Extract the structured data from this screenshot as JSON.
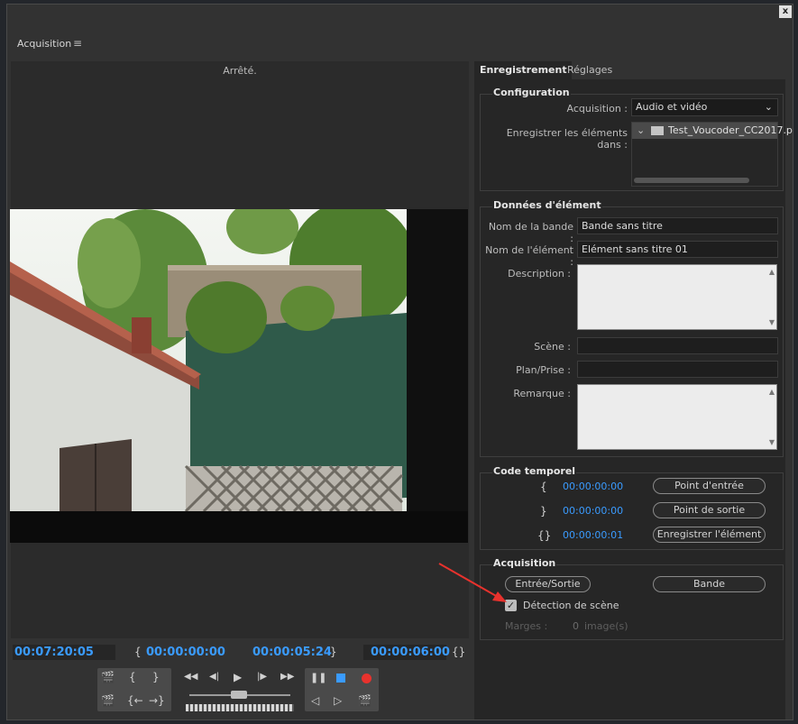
{
  "panel": {
    "title": "Acquisition",
    "menu_icon": "hamburger-icon",
    "close_label": "x"
  },
  "preview": {
    "status": "Arrêté.",
    "timecodes": {
      "current": "00:07:20:05",
      "in": "00:00:00:00",
      "duration": "00:00:05:24",
      "out": "00:00:06:00"
    }
  },
  "tabs": [
    {
      "label": "Enregistrement",
      "active": true
    },
    {
      "label": "Réglages",
      "active": false
    }
  ],
  "configuration": {
    "title": "Configuration",
    "acquisition_label": "Acquisition :",
    "acquisition_value": "Audio et vidéo",
    "save_label": "Enregistrer les éléments dans :",
    "save_folder": "Test_Voucoder_CC2017.p"
  },
  "clip_data": {
    "title": "Données d'élément",
    "tape_label": "Nom de la bande :",
    "tape_value": "Bande sans titre",
    "clip_label": "Nom de l'élément :",
    "clip_value": "Elément sans titre 01",
    "description_label": "Description :",
    "scene_label": "Scène :",
    "shot_label": "Plan/Prise :",
    "remark_label": "Remarque :"
  },
  "timecode": {
    "title": "Code temporel",
    "in_value": "00:00:00:00",
    "out_value": "00:00:00:00",
    "duration_value": "00:00:00:01",
    "set_in": "Point d'entrée",
    "set_out": "Point de sortie",
    "log_clip": "Enregistrer l'élément"
  },
  "capture": {
    "title": "Acquisition",
    "in_out_button": "Entrée/Sortie",
    "tape_button": "Bande",
    "scene_detect_label": "Détection de scène",
    "scene_detect_checked": true,
    "handles_label": "Marges :",
    "handles_value": "0",
    "handles_unit": "image(s)"
  },
  "colors": {
    "accent": "#3a9bff",
    "record": "#e8322d",
    "stop": "#3a9bff"
  }
}
